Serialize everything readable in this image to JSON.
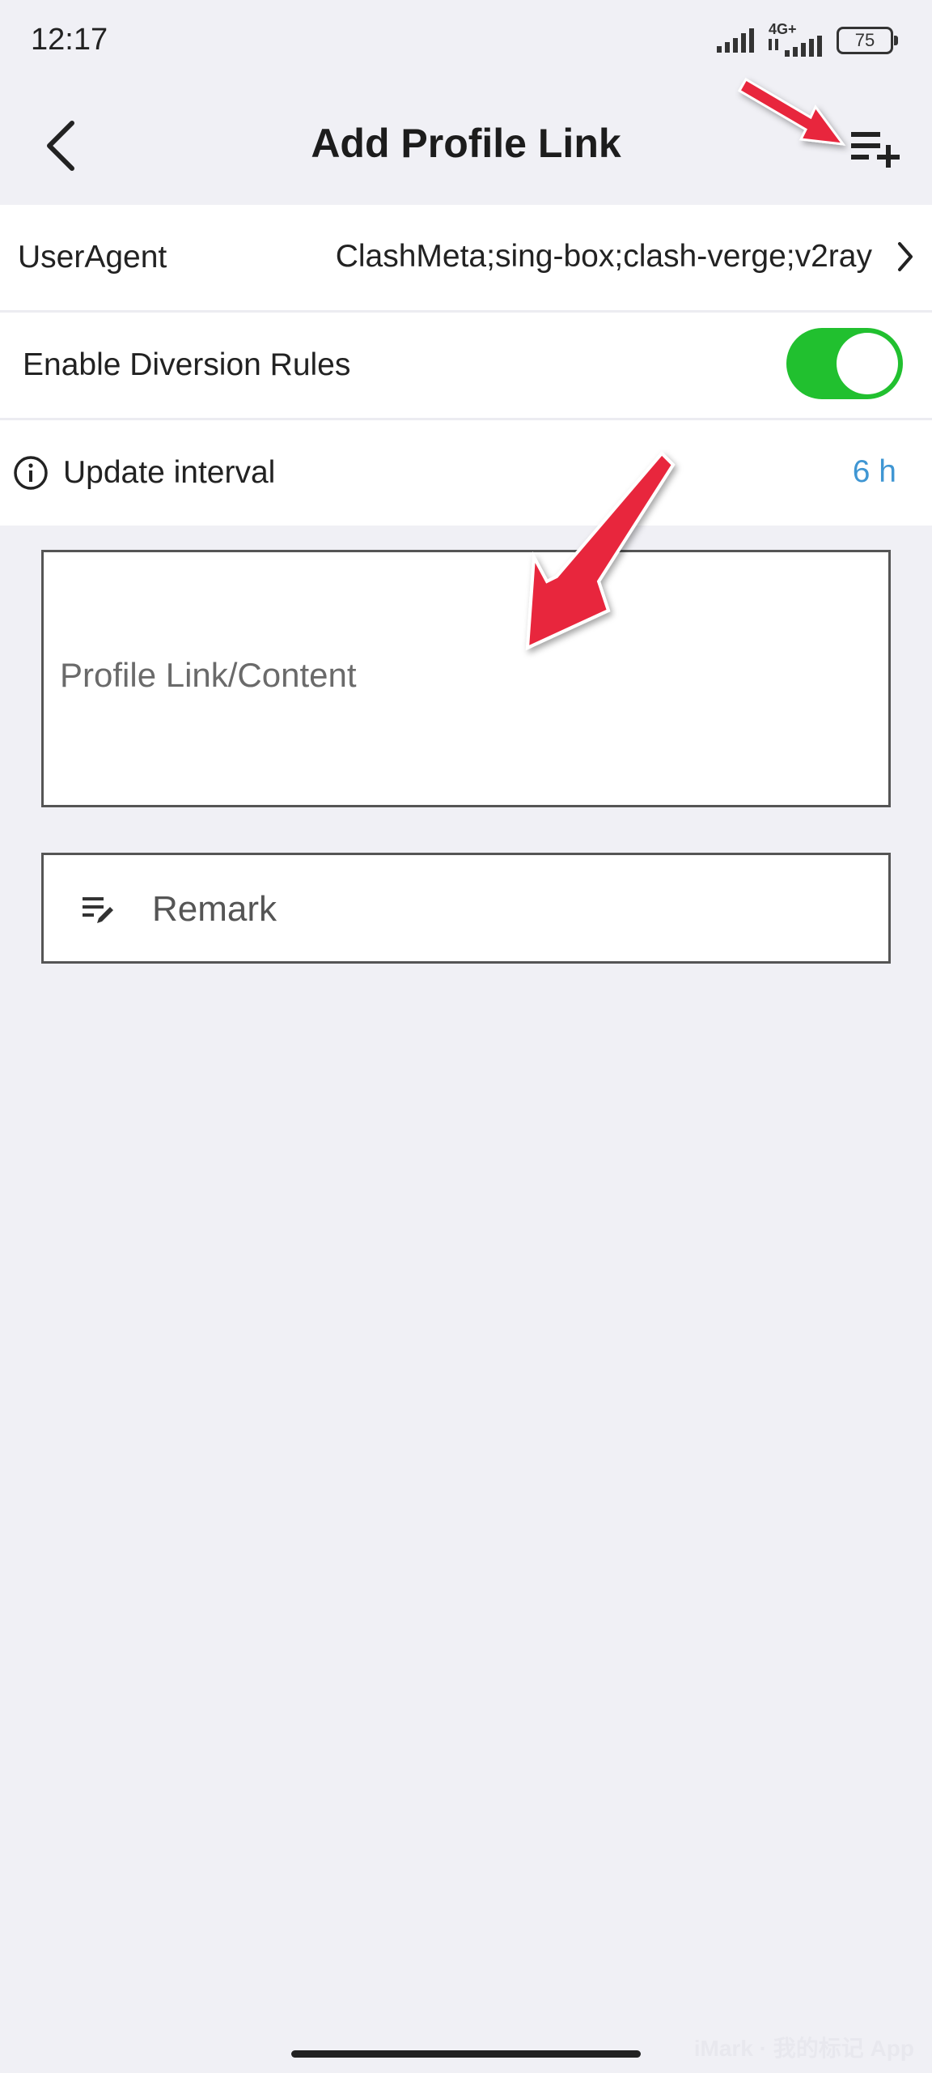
{
  "status_bar": {
    "time": "12:17",
    "network_label": "4G+",
    "battery_level": "75"
  },
  "header": {
    "title": "Add Profile Link",
    "back_icon": "chevron-left-icon",
    "add_icon": "playlist-add-icon"
  },
  "settings": {
    "user_agent": {
      "label": "UserAgent",
      "value": "ClashMeta;sing-box;clash-verge;v2ray"
    },
    "diversion_rules": {
      "label": "Enable Diversion Rules",
      "enabled": true,
      "toggle_color": "#21c02f"
    },
    "update_interval": {
      "label": "Update interval",
      "value": "6 h",
      "value_color": "#3f96d3"
    }
  },
  "form": {
    "content_placeholder": "Profile Link/Content",
    "remark_placeholder": "Remark"
  },
  "annotation": {
    "arrow_color": "#e8283c"
  },
  "watermark": "iMark · 我的标记 App"
}
